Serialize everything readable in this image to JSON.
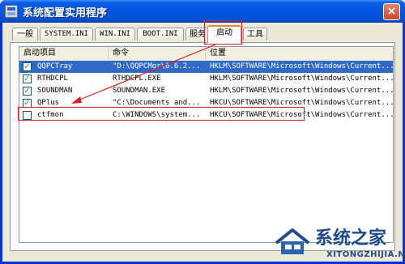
{
  "window": {
    "title": "系统配置实用程序",
    "close_glyph": "×"
  },
  "tabs": [
    {
      "label": "一般"
    },
    {
      "label": "SYSTEM.INI"
    },
    {
      "label": "WIN.INI"
    },
    {
      "label": "BOOT.INI"
    },
    {
      "label": "服务"
    },
    {
      "label": "启动"
    },
    {
      "label": "工具"
    }
  ],
  "active_tab": "启动",
  "startup_list": {
    "columns": [
      "启动项目",
      "命令",
      "位置"
    ],
    "rows": [
      {
        "name": "QQPCTray",
        "command": "\"D:\\QQPCMgr\\6.6.2...",
        "location": "HKLM\\SOFTWARE\\Microsoft\\Windows\\Current...",
        "checked": true,
        "selected": true
      },
      {
        "name": "RTHDCPL",
        "command": "RTHDCPL.EXE",
        "location": "HKLM\\SOFTWARE\\Microsoft\\Windows\\Current...",
        "checked": true,
        "selected": false
      },
      {
        "name": "SOUNDMAN",
        "command": "SOUNDMAN.EXE",
        "location": "HKLM\\SOFTWARE\\Microsoft\\Windows\\Current...",
        "checked": true,
        "selected": false
      },
      {
        "name": "QPlus",
        "command": "\"C:\\Documents and...",
        "location": "HKCU\\SOFTWARE\\Microsoft\\Windows\\Current...",
        "checked": true,
        "selected": false
      },
      {
        "name": "ctfmon",
        "command": "C:\\WINDOWS\\system...",
        "location": "HKCU\\SOFTWARE\\Microsoft\\Windows\\Current...",
        "checked": false,
        "selected": false
      }
    ]
  },
  "icons": {
    "app": "system-config-icon",
    "check": "checkmark-icon"
  },
  "colors": {
    "titlebar": "#0454E0",
    "selection": "#316AC5",
    "annotation": "#E02020",
    "active_tab_accent": "#E68B2C"
  },
  "watermark": {
    "brand": "系统之家",
    "url": "XITONGZHIJIA.NET"
  }
}
